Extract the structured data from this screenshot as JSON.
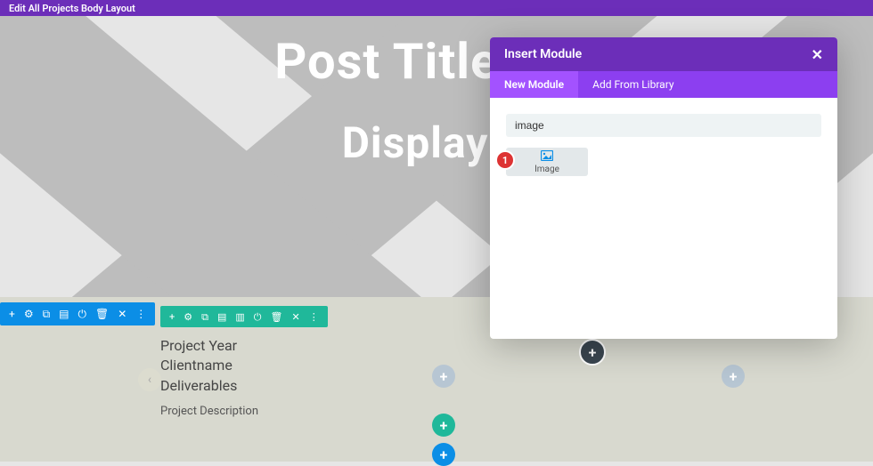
{
  "topbar": {
    "title": "Edit All Projects Body Layout"
  },
  "hero": {
    "title": "Post Title Will",
    "subtitle": "Display H"
  },
  "section_toolbar": {
    "icons": [
      "add-icon",
      "settings-icon",
      "duplicate-icon",
      "save-library-icon",
      "power-icon",
      "delete-icon",
      "close-icon",
      "more-icon"
    ]
  },
  "row_toolbar": {
    "icons": [
      "add-icon",
      "settings-icon",
      "duplicate-icon",
      "save-library-icon",
      "columns-icon",
      "power-icon",
      "delete-icon",
      "close-icon",
      "more-icon"
    ]
  },
  "project": {
    "lines": [
      "Project Year",
      "Clientname",
      "Deliverables"
    ],
    "description": "Project Description"
  },
  "modal": {
    "title": "Insert Module",
    "tabs": {
      "new": "New Module",
      "library": "Add From Library"
    },
    "search": {
      "value": "image"
    },
    "results": [
      {
        "label": "Image"
      }
    ],
    "annotation": "1"
  },
  "glyphs": {
    "plus": "+",
    "close": "✕",
    "more": "⋮",
    "gear": "⚙",
    "trash": "🗑",
    "power": "⏻",
    "dup": "⧉",
    "lib": "▤",
    "cols": "▥",
    "left": "‹"
  }
}
